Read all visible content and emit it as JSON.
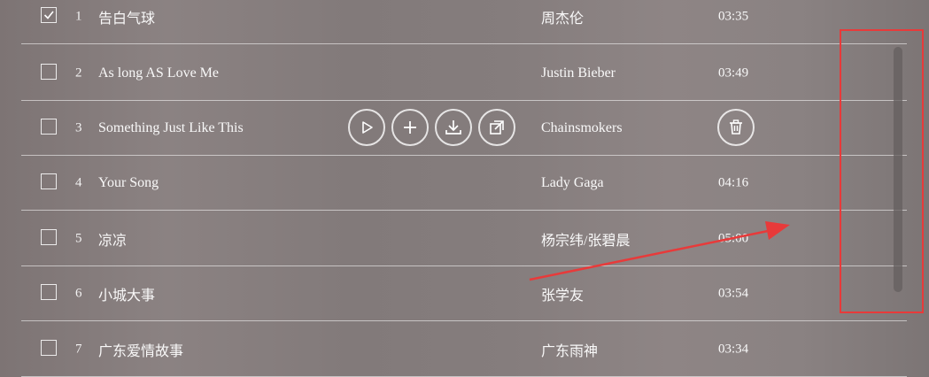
{
  "songs": [
    {
      "num": "1",
      "title": "告白气球",
      "artist": "周杰伦",
      "duration": "03:35",
      "checked": true
    },
    {
      "num": "2",
      "title": "As long AS Love Me",
      "artist": "Justin Bieber",
      "duration": "03:49",
      "checked": false
    },
    {
      "num": "3",
      "title": "Something Just Like This",
      "artist": "Chainsmokers",
      "duration": "",
      "checked": false
    },
    {
      "num": "4",
      "title": "Your Song",
      "artist": "Lady Gaga",
      "duration": "04:16",
      "checked": false
    },
    {
      "num": "5",
      "title": "凉凉",
      "artist": "杨宗纬/张碧晨",
      "duration": "05:00",
      "checked": false
    },
    {
      "num": "6",
      "title": "小城大事",
      "artist": "张学友",
      "duration": "03:54",
      "checked": false
    },
    {
      "num": "7",
      "title": "广东爱情故事",
      "artist": "广东雨神",
      "duration": "03:34",
      "checked": false
    }
  ],
  "hover_row_actions": [
    "play-icon",
    "add-icon",
    "download-icon",
    "share-icon",
    "trash-icon"
  ],
  "colors": {
    "annotation": "#e83a3a",
    "text": "#ffffff"
  }
}
